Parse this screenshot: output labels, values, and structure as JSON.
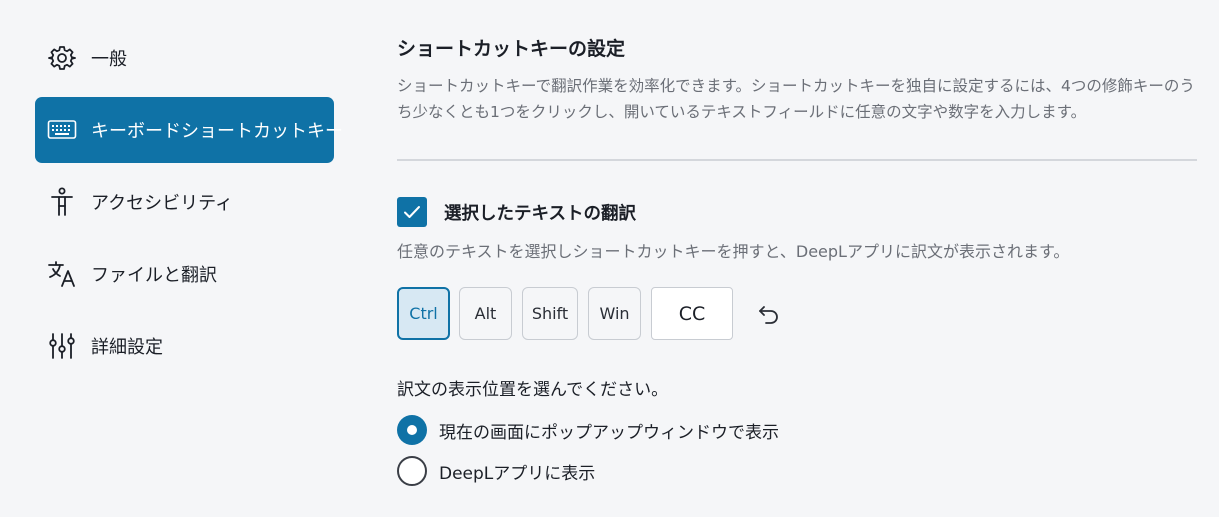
{
  "sidebar": {
    "items": [
      {
        "label": "一般",
        "icon": "gear-icon"
      },
      {
        "label": "キーボードショートカットキー",
        "icon": "keyboard-icon",
        "active": true
      },
      {
        "label": "アクセシビリティ",
        "icon": "accessibility-icon"
      },
      {
        "label": "ファイルと翻訳",
        "icon": "translate-icon"
      },
      {
        "label": "詳細設定",
        "icon": "sliders-icon"
      }
    ]
  },
  "main": {
    "title": "ショートカットキーの設定",
    "description": "ショートカットキーで翻訳作業を効率化できます。ショートカットキーを独自に設定するには、4つの修飾キーのうち少なくとも1つをクリックし、開いているテキストフィールドに任意の文字や数字を入力します。",
    "shortcut": {
      "checked": true,
      "label": "選択したテキストの翻訳",
      "description": "任意のテキストを選択しショートカットキーを押すと、DeepLアプリに訳文が表示されます。",
      "modifiers": [
        {
          "label": "Ctrl",
          "selected": true
        },
        {
          "label": "Alt",
          "selected": false
        },
        {
          "label": "Shift",
          "selected": false
        },
        {
          "label": "Win",
          "selected": false
        }
      ],
      "key_value": "CC",
      "reset_icon": "undo-icon"
    },
    "position": {
      "label": "訳文の表示位置を選んでください。",
      "options": [
        {
          "label": "現在の画面にポップアップウィンドウで表示",
          "selected": true
        },
        {
          "label": "DeepLアプリに表示",
          "selected": false
        }
      ]
    }
  },
  "colors": {
    "accent": "#0f72a6",
    "background": "#f5f6f8",
    "muted_text": "#6b6f77"
  }
}
